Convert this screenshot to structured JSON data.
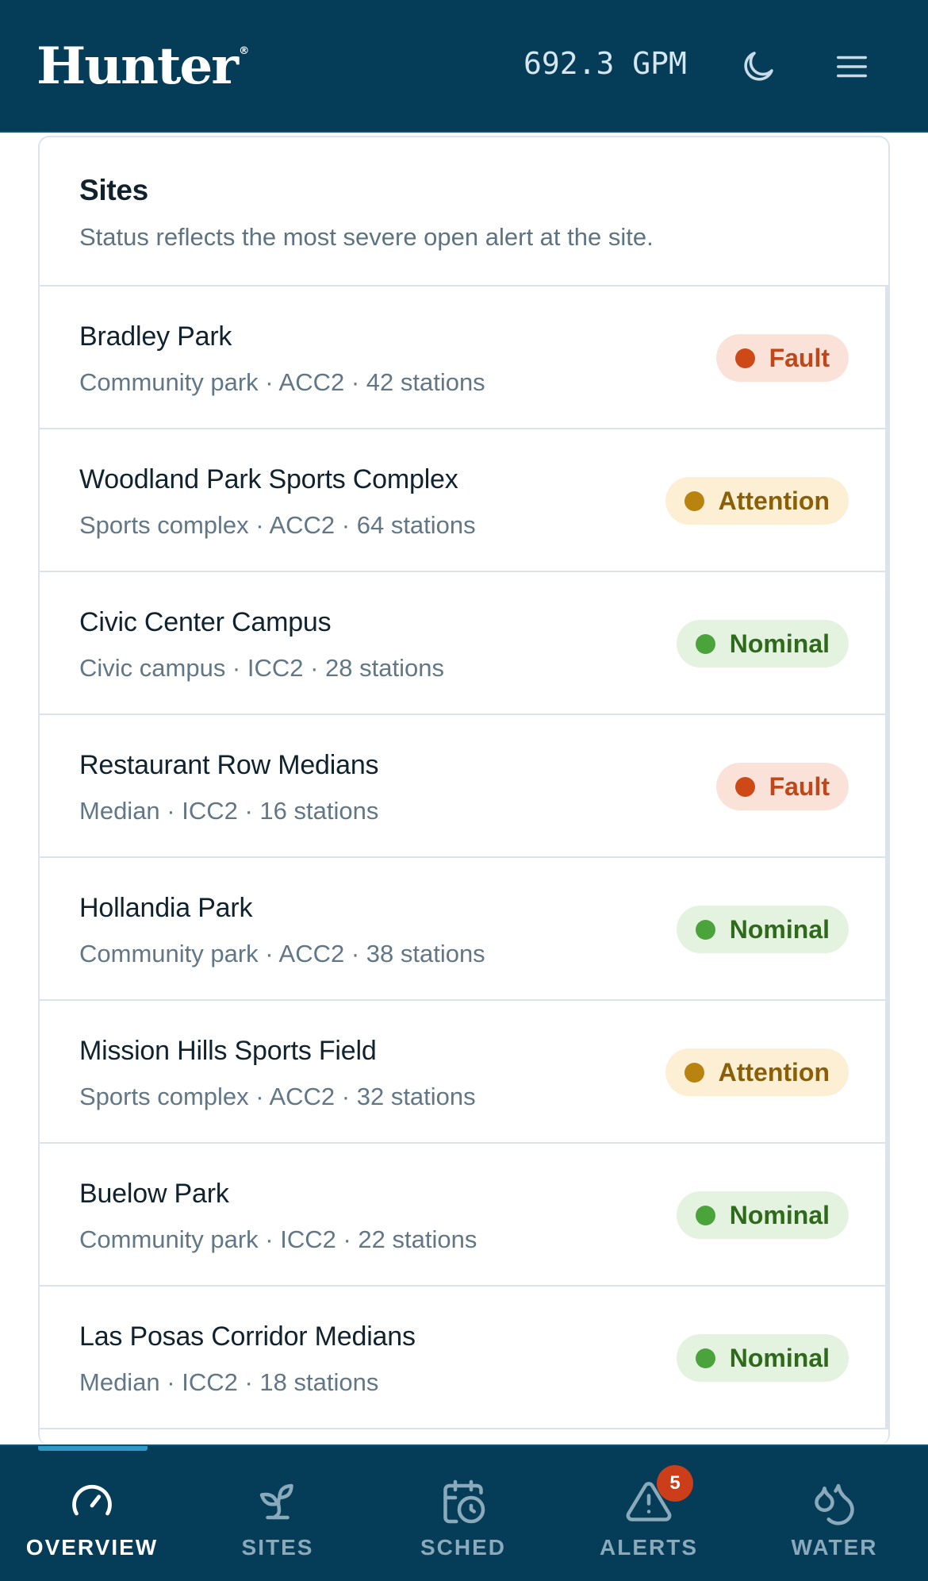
{
  "header": {
    "brand": "Hunter",
    "brand_mark": "®",
    "flow_readout": "692.3 GPM",
    "theme_icon": "moon-icon",
    "menu_icon": "hamburger-menu-icon"
  },
  "sites_panel": {
    "title": "Sites",
    "subtitle": "Status reflects the most severe open alert at the site."
  },
  "sites": [
    {
      "name": "Bradley Park",
      "meta": "Community park · ACC2 · 42 stations",
      "status": "Fault"
    },
    {
      "name": "Woodland Park Sports Complex",
      "meta": "Sports complex · ACC2 · 64 stations",
      "status": "Attention"
    },
    {
      "name": "Civic Center Campus",
      "meta": "Civic campus · ICC2 · 28 stations",
      "status": "Nominal"
    },
    {
      "name": "Restaurant Row Medians",
      "meta": "Median · ICC2 · 16 stations",
      "status": "Fault"
    },
    {
      "name": "Hollandia Park",
      "meta": "Community park · ACC2 · 38 stations",
      "status": "Nominal"
    },
    {
      "name": "Mission Hills Sports Field",
      "meta": "Sports complex · ACC2 · 32 stations",
      "status": "Attention"
    },
    {
      "name": "Buelow Park",
      "meta": "Community park · ICC2 · 22 stations",
      "status": "Nominal"
    },
    {
      "name": "Las Posas Corridor Medians",
      "meta": "Median · ICC2 · 18 stations",
      "status": "Nominal"
    }
  ],
  "colors": {
    "header_bg": "#053c57",
    "fault": "#cd4a17",
    "attention": "#b9830f",
    "nominal": "#4aa33b",
    "active_indicator": "#2f98c5"
  },
  "nav": {
    "items": [
      {
        "label": "OVERVIEW",
        "icon": "gauge-icon",
        "active": true
      },
      {
        "label": "SITES",
        "icon": "sprout-icon"
      },
      {
        "label": "SCHED",
        "icon": "calendar-clock-icon"
      },
      {
        "label": "ALERTS",
        "icon": "alert-triangle-icon",
        "badge": "5"
      },
      {
        "label": "WATER",
        "icon": "water-drops-icon"
      }
    ]
  }
}
